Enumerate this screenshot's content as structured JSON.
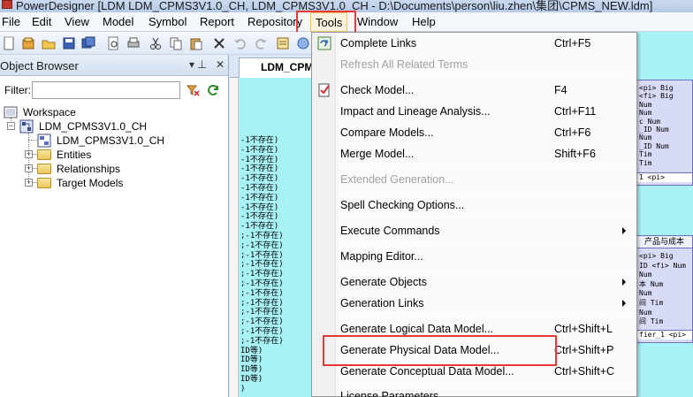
{
  "window": {
    "title": "PowerDesigner [LDM LDM_CPMS3V1.0_CH, LDM_CPMS3V1.0_CH - D:\\Documents\\person\\liu.zhen\\集团\\CPMS_NEW.ldm]"
  },
  "menubar": {
    "items": [
      {
        "label": "File"
      },
      {
        "label": "Edit"
      },
      {
        "label": "View"
      },
      {
        "label": "Model"
      },
      {
        "label": "Symbol"
      },
      {
        "label": "Report"
      },
      {
        "label": "Repository"
      },
      {
        "label": "Tools"
      },
      {
        "label": "Window"
      },
      {
        "label": "Help"
      }
    ]
  },
  "object_browser": {
    "title": "Object Browser",
    "pin_glyph": "▾ ⊥",
    "close_glyph": "✕",
    "filter_label": "Filter:",
    "filter_value": "",
    "tree": {
      "workspace": "Workspace",
      "model": "LDM_CPMS3V1.0_CH",
      "diagram": "LDM_CPMS3V1.0_CH",
      "entities": "Entities",
      "relationships": "Relationships",
      "target_models": "Target Models"
    }
  },
  "canvas": {
    "tab_label": "LDM_CPMS",
    "lines": [
      "-1不存在)",
      "-1不存在)",
      "-1不存在)",
      "-1不存在)",
      "-1不存在)",
      "-1不存在)",
      "-1不存在)",
      "-1不存在)",
      "-1不存在)",
      "-1不存在)",
      ";-1不存在)",
      ";-1不存在)",
      ";-1不存在)",
      ";-1不存在)",
      ";-1不存在)",
      ";-1不存在)",
      ";-1不存在)",
      ";-1不存在)",
      ";-1不存在)",
      ";-1不存在)",
      ";-1不存在)",
      ";-1不存在)",
      "ID等)",
      "ID等)",
      "ID等)",
      "ID等)",
      ")"
    ]
  },
  "right_entities": {
    "top": {
      "rows": [
        "<pi> Big",
        "<fi> Big",
        "Num",
        "Num",
        "c  Num",
        "_ID Num",
        "Num",
        "_ID Num",
        "Tim",
        "Tim"
      ],
      "footer": "1 <pi>"
    },
    "bottom": {
      "header": "产品与成本",
      "rows": [
        "<pi> Big",
        "ID <fi> Num",
        "Num",
        "本  Num",
        "Num",
        "间  Tim",
        "Num",
        "间  Tim"
      ],
      "footer": "fier_1 <pi>"
    }
  },
  "tools_menu": {
    "items": [
      {
        "label": "Complete Links",
        "shortcut": "Ctrl+F5",
        "disabled": false,
        "submenu": false,
        "icon": "complete-links-icon"
      },
      {
        "label": "Refresh All Related Terms",
        "shortcut": "",
        "disabled": true,
        "submenu": false
      },
      {
        "label": "Check Model...",
        "shortcut": "F4",
        "disabled": false,
        "submenu": false,
        "icon": "check-model-icon"
      },
      {
        "label": "Impact and Lineage Analysis...",
        "shortcut": "Ctrl+F11",
        "disabled": false,
        "submenu": false
      },
      {
        "label": "Compare Models...",
        "shortcut": "Ctrl+F6",
        "disabled": false,
        "submenu": false
      },
      {
        "label": "Merge Model...",
        "shortcut": "Shift+F6",
        "disabled": false,
        "submenu": false
      },
      {
        "label": "Extended Generation...",
        "shortcut": "",
        "disabled": true,
        "submenu": false
      },
      {
        "label": "Spell Checking Options...",
        "shortcut": "",
        "disabled": false,
        "submenu": false
      },
      {
        "label": "Execute Commands",
        "shortcut": "",
        "disabled": false,
        "submenu": true
      },
      {
        "label": "Mapping Editor...",
        "shortcut": "",
        "disabled": false,
        "submenu": false
      },
      {
        "label": "Generate Objects",
        "shortcut": "",
        "disabled": false,
        "submenu": true
      },
      {
        "label": "Generation Links",
        "shortcut": "",
        "disabled": false,
        "submenu": true
      },
      {
        "label": "Generate Logical Data Model...",
        "shortcut": "Ctrl+Shift+L",
        "disabled": false,
        "submenu": false
      },
      {
        "label": "Generate Physical Data Model...",
        "shortcut": "Ctrl+Shift+P",
        "disabled": false,
        "submenu": false
      },
      {
        "label": "Generate Conceptual Data Model...",
        "shortcut": "Ctrl+Shift+C",
        "disabled": false,
        "submenu": false
      },
      {
        "label": "License Parameters...",
        "shortcut": "",
        "disabled": false,
        "submenu": false
      }
    ]
  },
  "colors": {
    "highlight_red": "#e53935",
    "diagram_cyan": "#a8f1f4",
    "entity_fill": "#d8dbf6"
  }
}
